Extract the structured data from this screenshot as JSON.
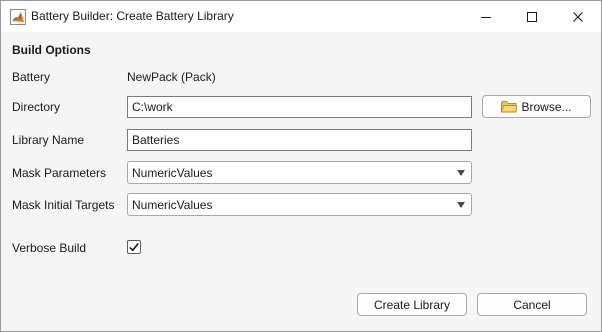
{
  "window": {
    "title": "Battery Builder: Create Battery Library",
    "app_icon": "matlab-logo-icon",
    "controls": [
      "minimize-icon",
      "maximize-icon",
      "close-icon"
    ]
  },
  "build_options": {
    "section_title": "Build Options",
    "battery": {
      "label": "Battery",
      "value": "NewPack (Pack)"
    },
    "directory": {
      "label": "Directory",
      "value": "C:\\work",
      "browse_label": "Browse...",
      "browse_icon": "folder-icon"
    },
    "library_name": {
      "label": "Library Name",
      "value": "Batteries"
    },
    "mask_parameters": {
      "label": "Mask Parameters",
      "selected": "NumericValues"
    },
    "mask_initial_targets": {
      "label": "Mask Initial Targets",
      "selected": "NumericValues"
    },
    "verbose_build": {
      "label": "Verbose Build",
      "checked": true
    }
  },
  "footer": {
    "create_label": "Create Library",
    "cancel_label": "Cancel"
  }
}
